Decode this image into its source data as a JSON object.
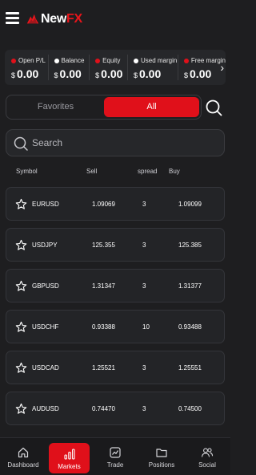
{
  "app": {
    "brand_part1": "New",
    "brand_part2": "FX"
  },
  "stats": [
    {
      "label": "Open P/L",
      "currency": "$",
      "value": "0.00",
      "dot_color": "#e0101a"
    },
    {
      "label": "Balance",
      "currency": "$",
      "value": "0.00",
      "dot_color": "#ffffff"
    },
    {
      "label": "Equity",
      "currency": "$",
      "value": "0.00",
      "dot_color": "#e0101a"
    },
    {
      "label": "Used margin",
      "currency": "$",
      "value": "0.00",
      "dot_color": "#ffffff"
    },
    {
      "label": "Free margin",
      "currency": "$",
      "value": "0.00",
      "dot_color": "#e0101a"
    }
  ],
  "tabs": {
    "favorites": "Favorites",
    "all": "All",
    "active": "All"
  },
  "search": {
    "placeholder": "Search"
  },
  "columns": {
    "symbol": "Symbol",
    "sell": "Sell",
    "spread": "spread",
    "buy": "Buy"
  },
  "rows": [
    {
      "symbol": "EURUSD",
      "sell": "1.09069",
      "spread": "3",
      "buy": "1.09099"
    },
    {
      "symbol": "USDJPY",
      "sell": "125.355",
      "spread": "3",
      "buy": "125.385"
    },
    {
      "symbol": "GBPUSD",
      "sell": "1.31347",
      "spread": "3",
      "buy": "1.31377"
    },
    {
      "symbol": "USDCHF",
      "sell": "0.93388",
      "spread": "10",
      "buy": "0.93488"
    },
    {
      "symbol": "USDCAD",
      "sell": "1.25521",
      "spread": "3",
      "buy": "1.25551"
    },
    {
      "symbol": "AUDUSD",
      "sell": "0.74470",
      "spread": "3",
      "buy": "0.74500"
    }
  ],
  "nav": [
    {
      "label": "Dashboard",
      "icon": "home-icon"
    },
    {
      "label": "Markets",
      "icon": "bar-chart-icon",
      "active": true
    },
    {
      "label": "Trade",
      "icon": "trade-chart-icon"
    },
    {
      "label": "Positions",
      "icon": "folder-icon"
    },
    {
      "label": "Social",
      "icon": "people-icon"
    }
  ],
  "colors": {
    "accent": "#e0101a",
    "background": "#1e1e20",
    "card": "#232427"
  }
}
